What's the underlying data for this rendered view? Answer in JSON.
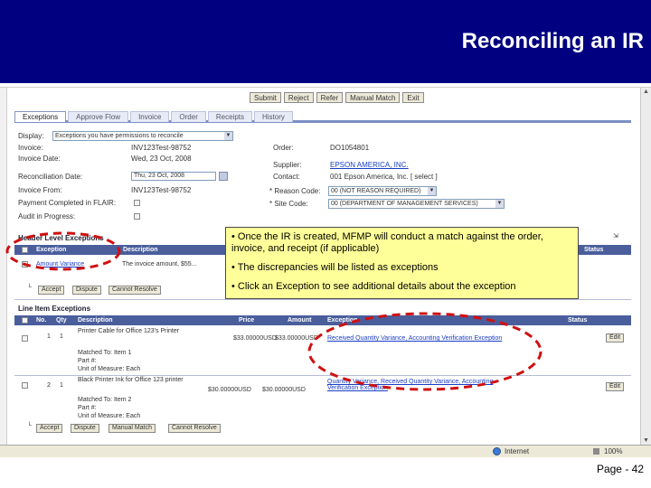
{
  "slide": {
    "title": "Reconciling an IR",
    "page_number": "Page - 42"
  },
  "toolbar": {
    "buttons": [
      "Submit",
      "Reject",
      "Refer",
      "Manual Match",
      "Exit"
    ]
  },
  "tabs": [
    "Exceptions",
    "Approve Flow",
    "Invoice",
    "Order",
    "Receipts",
    "History"
  ],
  "form": {
    "display_label": "Display:",
    "display_value": "Exceptions you have permissions to reconcile",
    "invoice_label": "Invoice:",
    "invoice_value": "INV123Test-98752",
    "invoice_date_label": "Invoice Date:",
    "invoice_date_value": "Wed, 23 Oct, 2008",
    "reconciliation_date_label": "Reconciliation Date:",
    "reconciliation_date_value": "Thu, 23 Oct, 2008",
    "invoice_from_label": "Invoice From:",
    "invoice_from_value": "INV123Test-98752",
    "payment_completed_label": "Payment Completed in FLAIR:",
    "audit_label": "Audit in Progress:",
    "order_label": "Order:",
    "order_value": "DO1054801",
    "supplier_label": "Supplier:",
    "supplier_value": "EPSON AMERICA, INC.",
    "contact_label": "Contact:",
    "contact_value": "001 Epson America, Inc. [ select ]",
    "reason_code_label": "* Reason Code:",
    "reason_code_value": "00 (NOT REASON REQUIRED)",
    "site_code_label": "* Site Code:",
    "site_code_value": "00 (DEPARTMENT OF MANAGEMENT SERVICES)"
  },
  "header_exceptions": {
    "title": "Header Level Exceptions",
    "columns": [
      "Exception",
      "Description",
      "Status"
    ],
    "row": {
      "exception": "Amount Variance",
      "description": "The invoice amount, $55..."
    },
    "buttons": [
      "Accept",
      "Dispute",
      "Cannot Resolve"
    ]
  },
  "line_exceptions": {
    "title": "Line Item Exceptions",
    "columns": [
      "No.",
      "Qty",
      "Description",
      "Price",
      "Amount",
      "Exception",
      "Status"
    ],
    "rows": [
      {
        "no": "1",
        "qty": "1",
        "description": "Printer Cable for Office 123's Printer",
        "price": "$33.00000USD",
        "amount": "$33.00000USD",
        "exception": "Received Quantity Variance, Accounting Verification Exception",
        "matched_label": "Matched To: Item 1",
        "part_label": "Part #:",
        "uom_label": "Unit of Measure: Each",
        "action": "Edit"
      },
      {
        "no": "2",
        "qty": "1",
        "description": "Black Printer Ink for Office 123 printer",
        "price": "$30.00000USD",
        "amount": "$30.00000USD",
        "exception": "Quantity Variance, Received Quantity Variance, Accounting Verification Exception",
        "matched_label": "Matched To: Item 2",
        "part_label": "Part #:",
        "uom_label": "Unit of Measure: Each",
        "action": "Edit"
      }
    ],
    "buttons": [
      "Accept",
      "Dispute",
      "Manual Match",
      "Cannot Resolve"
    ]
  },
  "callout": {
    "bullets": [
      "• Once the IR is created, MFMP will conduct a match against the order, invoice, and receipt (if applicable)",
      "• The discrepancies will be listed as exceptions",
      "• Click an Exception to see additional details about the exception"
    ]
  },
  "statusbar": {
    "zone": "Internet",
    "zoom": "100%"
  },
  "colors": {
    "title_band": "#000080",
    "callout_bg": "#ffff99",
    "annotation_red": "#d01010",
    "table_header": "#4a5e9c"
  }
}
